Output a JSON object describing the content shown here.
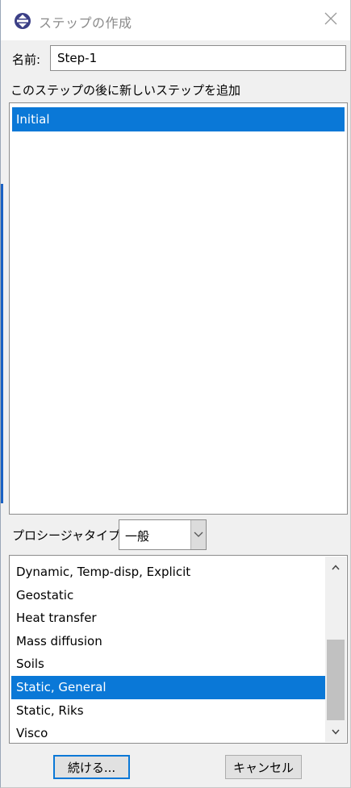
{
  "window": {
    "title": "ステップの作成",
    "app_icon": "abaqus-icon",
    "close_icon": "close-icon"
  },
  "name_field": {
    "label": "名前:",
    "value": "Step-1"
  },
  "insert_after": {
    "label": "このステップの後に新しいステップを追加",
    "steps": [
      "Initial"
    ],
    "selected": "Initial"
  },
  "procedure_type": {
    "label": "プロシージャタイプ:",
    "value": "一般",
    "dropdown_icon": "chevron-down-icon"
  },
  "procedures": {
    "items": [
      "Dynamic, Temp-disp, Explicit",
      "Geostatic",
      "Heat transfer",
      "Mass diffusion",
      "Soils",
      "Static, General",
      "Static, Riks",
      "Visco"
    ],
    "selected": "Static, General"
  },
  "buttons": {
    "continue": "続ける...",
    "cancel": "キャンセル"
  },
  "colors": {
    "selection": "#0a78d7",
    "title_text": "#8a8a8a"
  }
}
